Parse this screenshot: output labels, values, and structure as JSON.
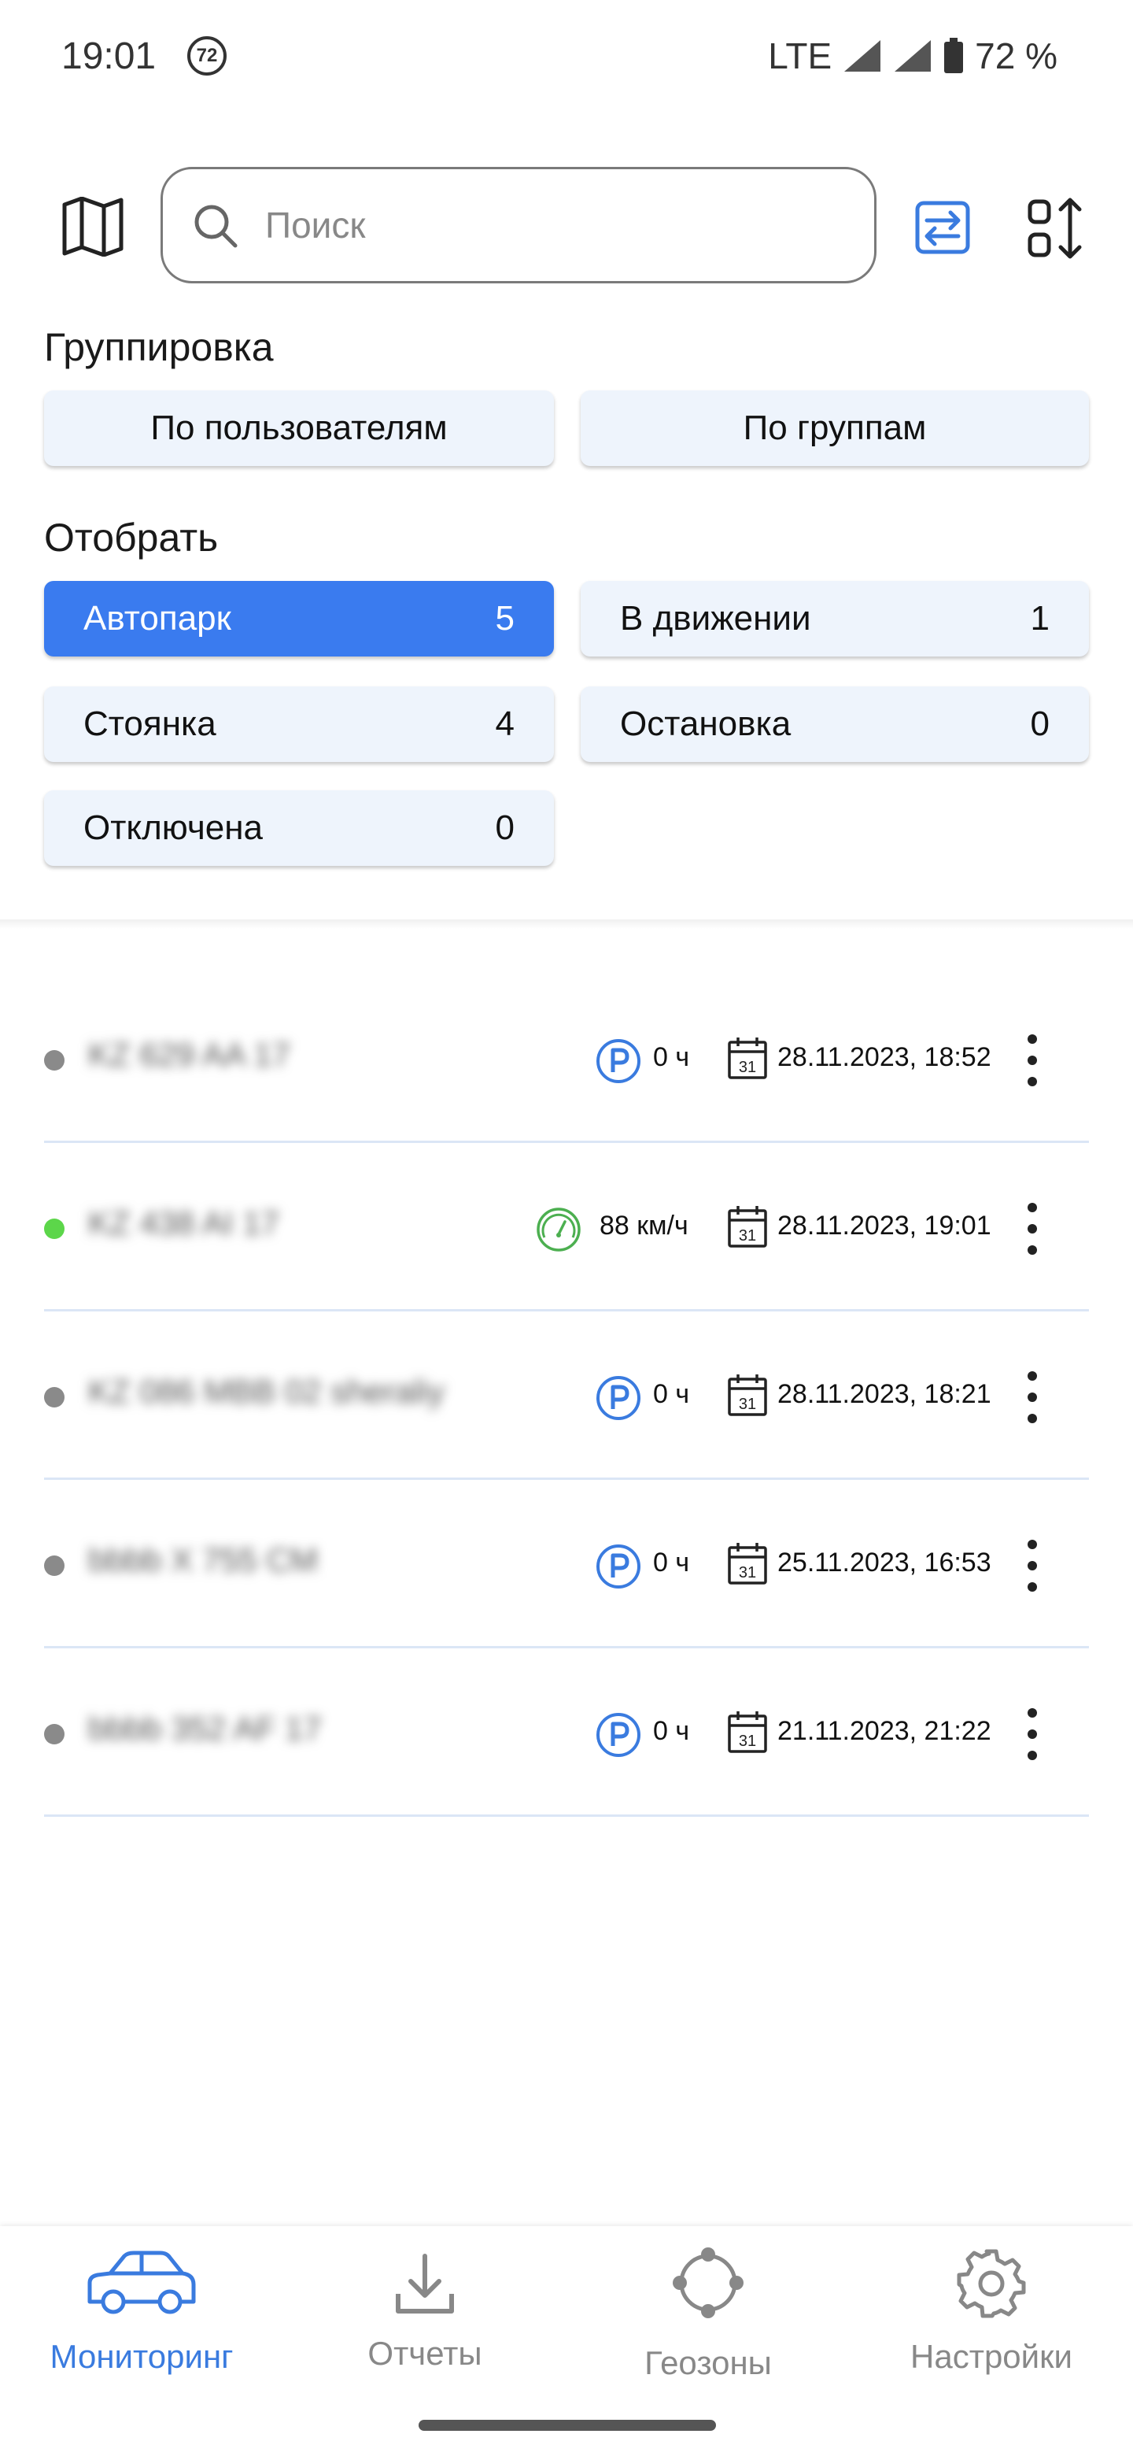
{
  "status_bar": {
    "time": "19:01",
    "notification_badge": "72",
    "network": "LTE",
    "battery": "72 %"
  },
  "search": {
    "placeholder": "Поиск",
    "value": ""
  },
  "grouping": {
    "title": "Группировка",
    "options": [
      "По пользователям",
      "По группам"
    ]
  },
  "filter": {
    "title": "Отобрать",
    "items": [
      {
        "label": "Автопарк",
        "count": "5",
        "active": true
      },
      {
        "label": "В движении",
        "count": "1",
        "active": false
      },
      {
        "label": "Стоянка",
        "count": "4",
        "active": false
      },
      {
        "label": "Остановка",
        "count": "0",
        "active": false
      },
      {
        "label": "Отключена",
        "count": "0",
        "active": false
      }
    ]
  },
  "vehicles": [
    {
      "plate": "KZ 629 AA 17",
      "state": "parked",
      "state_text": "0 ч",
      "datetime": "28.11.2023, 18:52",
      "online": false
    },
    {
      "plate": "KZ 438 AI 17",
      "state": "moving",
      "state_text": "88 км/ч",
      "datetime": "28.11.2023, 19:01",
      "online": true
    },
    {
      "plate": "KZ 086 MBB 02 sheraliy",
      "state": "parked",
      "state_text": "0 ч",
      "datetime": "28.11.2023, 18:21",
      "online": false
    },
    {
      "plate": "bbbb X 755 CM",
      "state": "parked",
      "state_text": "0 ч",
      "datetime": "25.11.2023, 16:53",
      "online": false
    },
    {
      "plate": "bbbb 352 AF 17",
      "state": "parked",
      "state_text": "0 ч",
      "datetime": "21.11.2023, 21:22",
      "online": false
    }
  ],
  "nav": {
    "items": [
      {
        "label": "Мониторинг",
        "icon": "car-icon",
        "active": true
      },
      {
        "label": "Отчеты",
        "icon": "download-icon",
        "active": false
      },
      {
        "label": "Геозоны",
        "icon": "geozone-icon",
        "active": false
      },
      {
        "label": "Настройки",
        "icon": "gear-icon",
        "active": false
      }
    ]
  },
  "colors": {
    "accent": "#3a7bef",
    "chip_bg": "#eef4fc",
    "online": "#5cd64a",
    "offline": "#8a8a8a",
    "parking_icon": "#3a7bdf",
    "speed_icon": "#4caf50"
  }
}
